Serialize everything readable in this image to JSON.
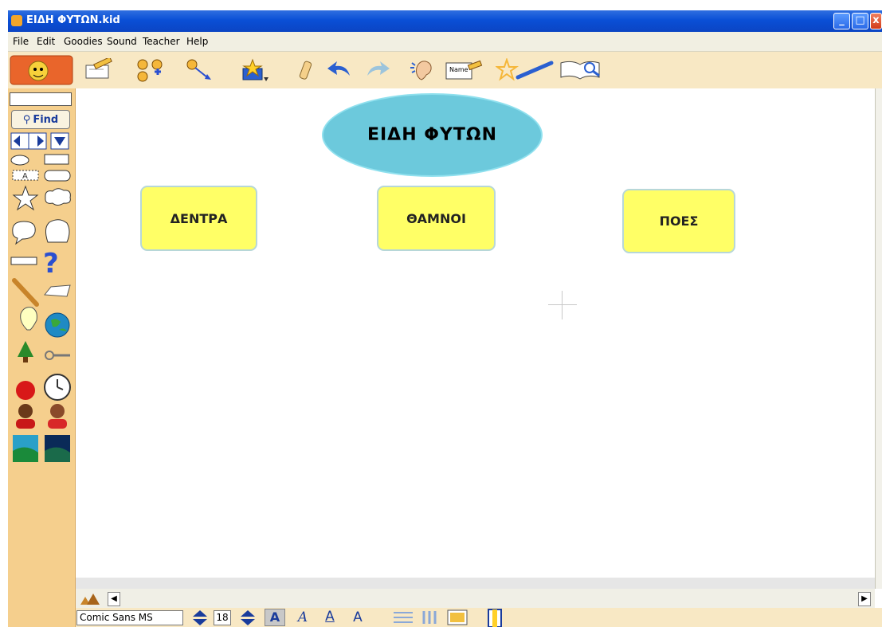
{
  "window": {
    "title": "ΕΙΔΗ ΦΥΤΩΝ.kid"
  },
  "menu": [
    "File",
    "Edit",
    "Goodies",
    "Sound",
    "Teacher",
    "Help"
  ],
  "palette": {
    "find_label": "Find",
    "text_tool_label": "A"
  },
  "canvas": {
    "main_topic": "ΕΙΔΗ ΦΥΤΩΝ",
    "subtopics": [
      "ΔΕΝΤΡΑ",
      "ΘΑΜΝΟΙ",
      "ΠΟΕΣ"
    ]
  },
  "format_bar": {
    "font_name": "Comic Sans MS",
    "font_size": "18",
    "bold_label": "A",
    "italic_label": "A",
    "underline_label": "A",
    "style_label": "A"
  },
  "colors": {
    "titlebar": "#0a4fd6",
    "palette": "#f5cf8d",
    "topic": "#6cc9dc",
    "subtopic": "#ffff66"
  }
}
